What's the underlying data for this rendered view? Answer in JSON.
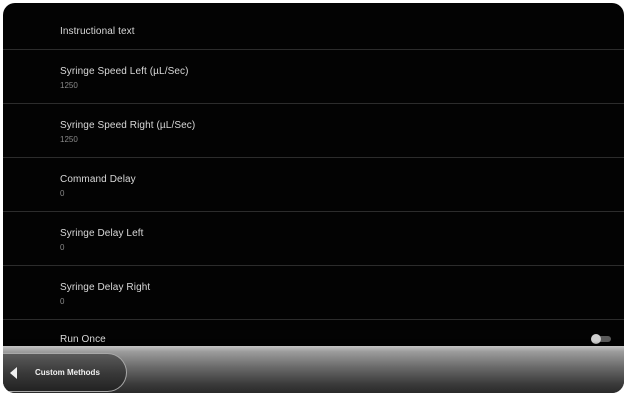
{
  "settings": {
    "header": "Instructional text",
    "rows": [
      {
        "label": "Syringe Speed Left (µL/Sec)",
        "value": "1250"
      },
      {
        "label": "Syringe Speed Right (µL/Sec)",
        "value": "1250"
      },
      {
        "label": "Command Delay",
        "value": "0"
      },
      {
        "label": "Syringe Delay Left",
        "value": "0"
      },
      {
        "label": "Syringe Delay Right",
        "value": "0"
      }
    ],
    "run_once": {
      "label": "Run Once",
      "enabled": false
    }
  },
  "bottom_bar": {
    "back_label": "Custom Methods",
    "back_icon": "back-arrow-icon"
  }
}
